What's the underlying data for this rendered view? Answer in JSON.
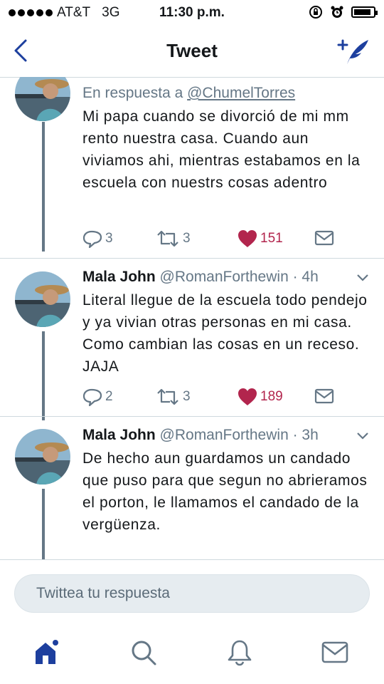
{
  "status_bar": {
    "carrier": "AT&T",
    "network": "3G",
    "time": "11:30 p.m."
  },
  "nav": {
    "title": "Tweet",
    "back_icon": "chevron-left-icon",
    "compose_icon": "compose-tweet-icon"
  },
  "colors": {
    "accent": "#1da1f2",
    "like": "#b2254d",
    "secondary": "#657786",
    "tab_active": "#1d3f9e"
  },
  "tweets": [
    {
      "reply_prefix": "En respuesta a",
      "reply_handle": "@ChumelTorres",
      "text": "Mi papa cuando se divorció de mi mm rento nuestra casa. Cuando aun viviamos ahi, mientras estabamos en la escuela con nuestrs cosas adentro",
      "replies": "3",
      "retweets": "3",
      "likes": "151"
    },
    {
      "name": "Mala John",
      "handle": "@RomanForthewin",
      "time": "· 4h",
      "text": "Literal llegue de la escuela todo pendejo y ya vivian otras personas en mi casa. Como cambian las cosas en un receso. JAJA",
      "replies": "2",
      "retweets": "3",
      "likes": "189"
    },
    {
      "name": "Mala John",
      "handle": "@RomanForthewin",
      "time": "· 3h",
      "text": "De hecho aun guardamos un candado que puso para que segun no abrieramos el porton, le llamamos el candado de la vergüenza."
    }
  ],
  "reply_box": {
    "placeholder": "Twittea tu respuesta"
  },
  "tabs": [
    {
      "icon": "home-icon",
      "active": true
    },
    {
      "icon": "search-icon"
    },
    {
      "icon": "notifications-bell-icon"
    },
    {
      "icon": "messages-envelope-icon"
    }
  ]
}
